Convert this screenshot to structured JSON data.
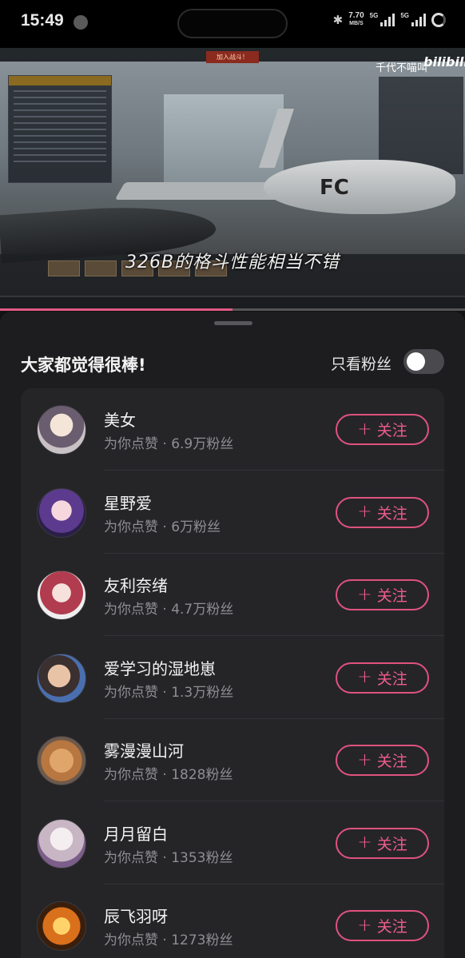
{
  "status_bar": {
    "time": "15:49",
    "speed_value": "7.70",
    "speed_unit": "MB/S",
    "sim1": "5G",
    "sim2": "5G"
  },
  "video": {
    "subtitle": "326B的格斗性能相当不错",
    "channel_name": "千代不喵叫",
    "brand": "bilibili",
    "join_button": "加入战斗！",
    "progress": 0.5
  },
  "sheet": {
    "title": "大家都觉得很棒!",
    "fans_only_label": "只看粉丝",
    "fans_only_enabled": false
  },
  "users": [
    {
      "name": "美女",
      "detail": "为你点赞 · 6.9万粉丝",
      "follow_label": "关注"
    },
    {
      "name": "星野爱",
      "detail": "为你点赞 · 6万粉丝",
      "follow_label": "关注"
    },
    {
      "name": "友利奈绪",
      "detail": "为你点赞 · 4.7万粉丝",
      "follow_label": "关注"
    },
    {
      "name": "爱学习的湿地崽",
      "detail": "为你点赞 · 1.3万粉丝",
      "follow_label": "关注"
    },
    {
      "name": "雾漫漫山河",
      "detail": "为你点赞 · 1828粉丝",
      "follow_label": "关注"
    },
    {
      "name": "月月留白",
      "detail": "为你点赞 · 1353粉丝",
      "follow_label": "关注"
    },
    {
      "name": "辰飞羽呀",
      "detail": "为你点赞 · 1273粉丝",
      "follow_label": "关注"
    }
  ],
  "colors": {
    "accent": "#e0527e",
    "sheet_bg": "#1d1d1f",
    "card_bg": "#252528"
  }
}
